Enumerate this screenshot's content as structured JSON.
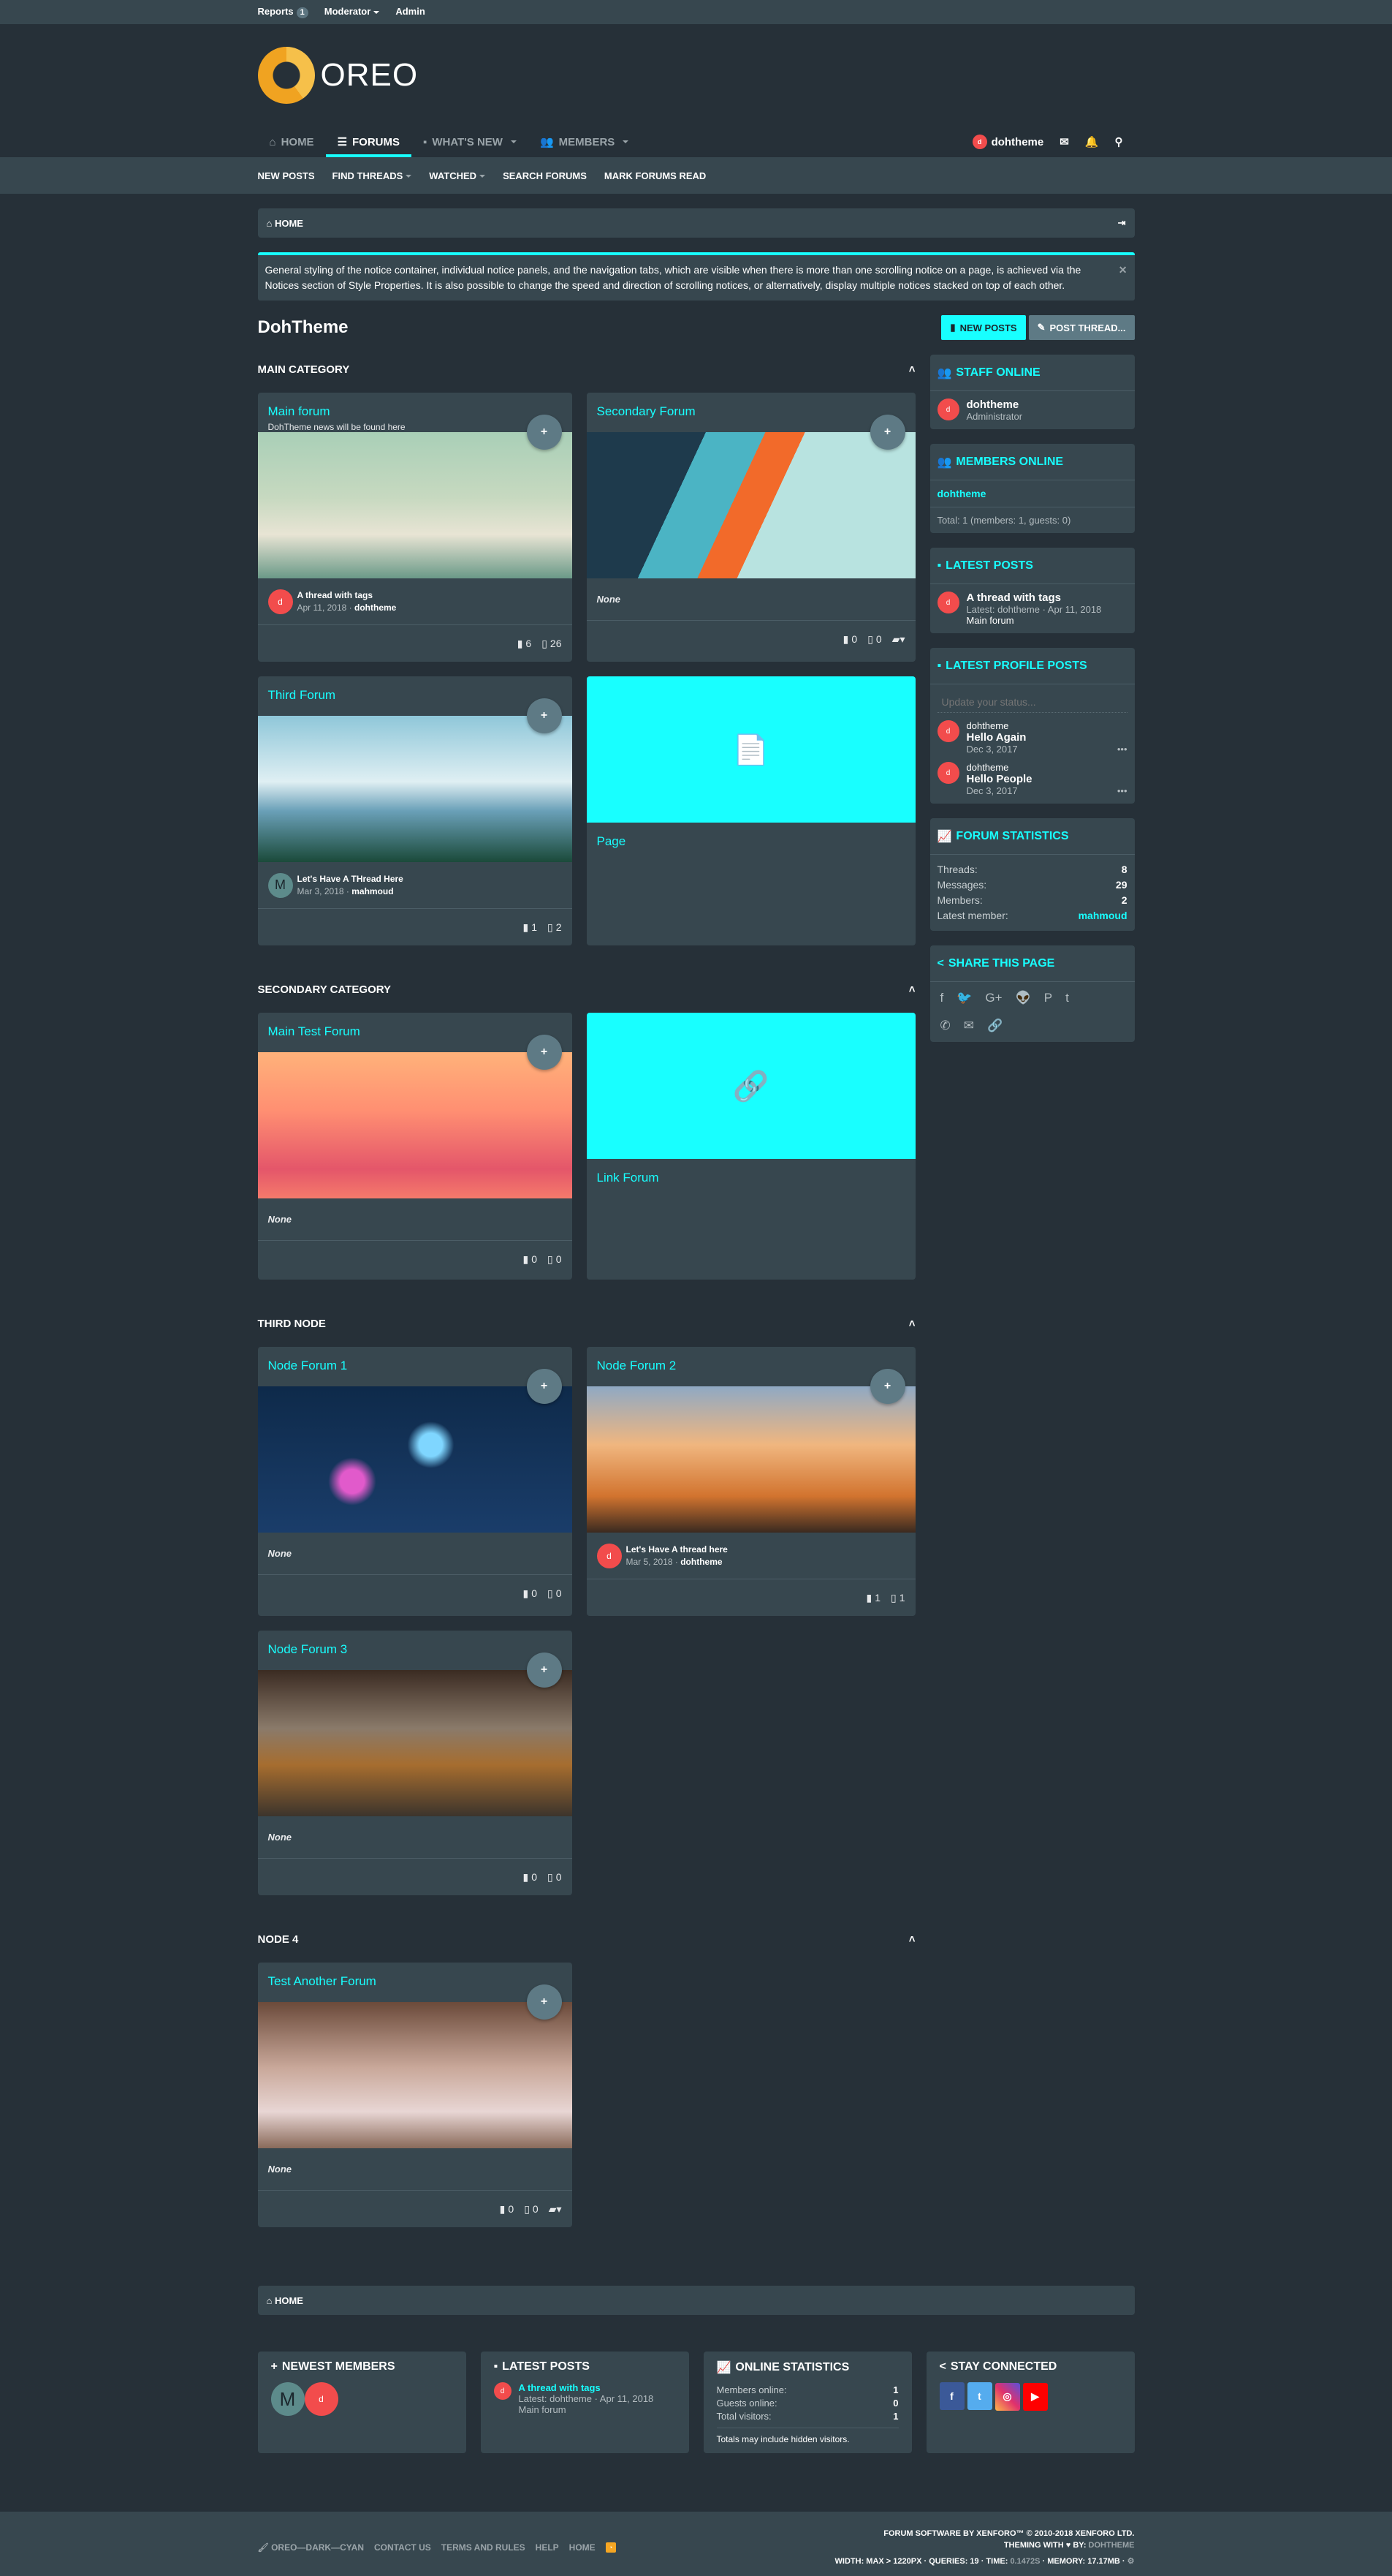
{
  "staffbar": {
    "reports": "Reports",
    "reports_count": "1",
    "moderator": "Moderator",
    "admin": "Admin"
  },
  "logo": {
    "text": "OREO"
  },
  "nav": {
    "tabs": [
      {
        "label": "HOME",
        "icon": "home-icon"
      },
      {
        "label": "FORUMS",
        "icon": "forums-icon",
        "active": true
      },
      {
        "label": "WHAT'S NEW",
        "icon": "whats-new-icon"
      },
      {
        "label": "MEMBERS",
        "icon": "members-icon"
      }
    ],
    "user": "dohtheme"
  },
  "subnav": [
    "NEW POSTS",
    "FIND THREADS",
    "WATCHED",
    "SEARCH FORUMS",
    "MARK FORUMS READ"
  ],
  "breadcrumb": {
    "home": "HOME"
  },
  "notice": "General styling of the notice container, individual notice panels, and the navigation tabs, which are visible when there is more than one scrolling notice on a page, is achieved via the Notices section of Style Properties. It is also possible to change the speed and direction of scrolling notices, or alternatively, display multiple notices stacked on top of each other.",
  "page": {
    "title": "DohTheme",
    "new_posts": "NEW POSTS",
    "post_thread": "POST THREAD..."
  },
  "categories": [
    {
      "title": "MAIN CATEGORY",
      "nodes": [
        {
          "name": "Main forum",
          "desc": "DohTheme news will be found here",
          "last_title": "A thread with tags",
          "last_date": "Apr 11, 2018",
          "last_user": "dohtheme",
          "avatar": "doh",
          "threads": "6",
          "messages": "26"
        },
        {
          "name": "Secondary Forum",
          "last_title": "None",
          "threads": "0",
          "messages": "0"
        },
        {
          "name": "Third Forum",
          "last_title": "Let's Have A THread Here",
          "last_date": "Mar 3, 2018",
          "last_user": "mahmoud",
          "avatar": "M",
          "threads": "1",
          "messages": "2"
        },
        {
          "name": "Page"
        }
      ]
    },
    {
      "title": "SECONDARY CATEGORY",
      "nodes": [
        {
          "name": "Main Test Forum",
          "last_title": "None",
          "threads": "0",
          "messages": "0"
        },
        {
          "name": "Link Forum"
        }
      ]
    },
    {
      "title": "THIRD NODE",
      "nodes": [
        {
          "name": "Node Forum 1",
          "last_title": "None",
          "threads": "0",
          "messages": "0"
        },
        {
          "name": "Node Forum 2",
          "last_title": "Let's Have A thread here",
          "last_date": "Mar 5, 2018",
          "last_user": "dohtheme",
          "avatar": "doh",
          "threads": "1",
          "messages": "1"
        },
        {
          "name": "Node Forum 3",
          "last_title": "None",
          "threads": "0",
          "messages": "0"
        }
      ]
    },
    {
      "title": "NODE 4",
      "nodes": [
        {
          "name": "Test Another Forum",
          "last_title": "None",
          "threads": "0",
          "messages": "0"
        }
      ]
    }
  ],
  "sidebar": {
    "staff": {
      "title": "STAFF ONLINE",
      "name": "dohtheme",
      "role": "Administrator"
    },
    "members": {
      "title": "MEMBERS ONLINE",
      "name": "dohtheme",
      "total": "Total: 1 (members: 1, guests: 0)"
    },
    "latest": {
      "title": "LATEST POSTS",
      "thread": "A thread with tags",
      "meta": "Latest: dohtheme · Apr 11, 2018",
      "forum": "Main forum"
    },
    "profile": {
      "title": "LATEST PROFILE POSTS",
      "placeholder": "Update your status...",
      "posts": [
        {
          "user": "dohtheme",
          "text": "Hello Again",
          "date": "Dec 3, 2017"
        },
        {
          "user": "dohtheme",
          "text": "Hello People",
          "date": "Dec 3, 2017"
        }
      ]
    },
    "stats": {
      "title": "FORUM STATISTICS",
      "threads_l": "Threads:",
      "threads": "8",
      "messages_l": "Messages:",
      "messages": "29",
      "members_l": "Members:",
      "members": "2",
      "latest_l": "Latest member:",
      "latest": "mahmoud"
    },
    "share": {
      "title": "SHARE THIS PAGE"
    }
  },
  "bottom_home": "HOME",
  "footer_blocks": {
    "newest": {
      "title": "NEWEST MEMBERS"
    },
    "latest": {
      "title": "LATEST POSTS",
      "thread": "A thread with tags",
      "meta": "Latest: dohtheme · Apr 11, 2018",
      "forum": "Main forum"
    },
    "online": {
      "title": "ONLINE STATISTICS",
      "members_l": "Members online:",
      "members": "1",
      "guests_l": "Guests online:",
      "guests": "0",
      "total_l": "Total visitors:",
      "total": "1",
      "note": "Totals may include hidden visitors."
    },
    "social": {
      "title": "STAY CONNECTED"
    }
  },
  "footer": {
    "style": "OREO—DARK—CYAN",
    "links": [
      "CONTACT US",
      "TERMS AND RULES",
      "HELP",
      "HOME"
    ],
    "copyright": "FORUM SOFTWARE BY XENFORO™ © 2010-2018 XENFORO LTD.",
    "theming": "THEMING WITH ♥ BY:",
    "theming_by": "DOHTHEME",
    "debug": "WIDTH: MAX > 1220PX · QUERIES: 19 · TIME:",
    "time": "0.1472S",
    "memory": "· MEMORY: 17.17MB ·"
  }
}
